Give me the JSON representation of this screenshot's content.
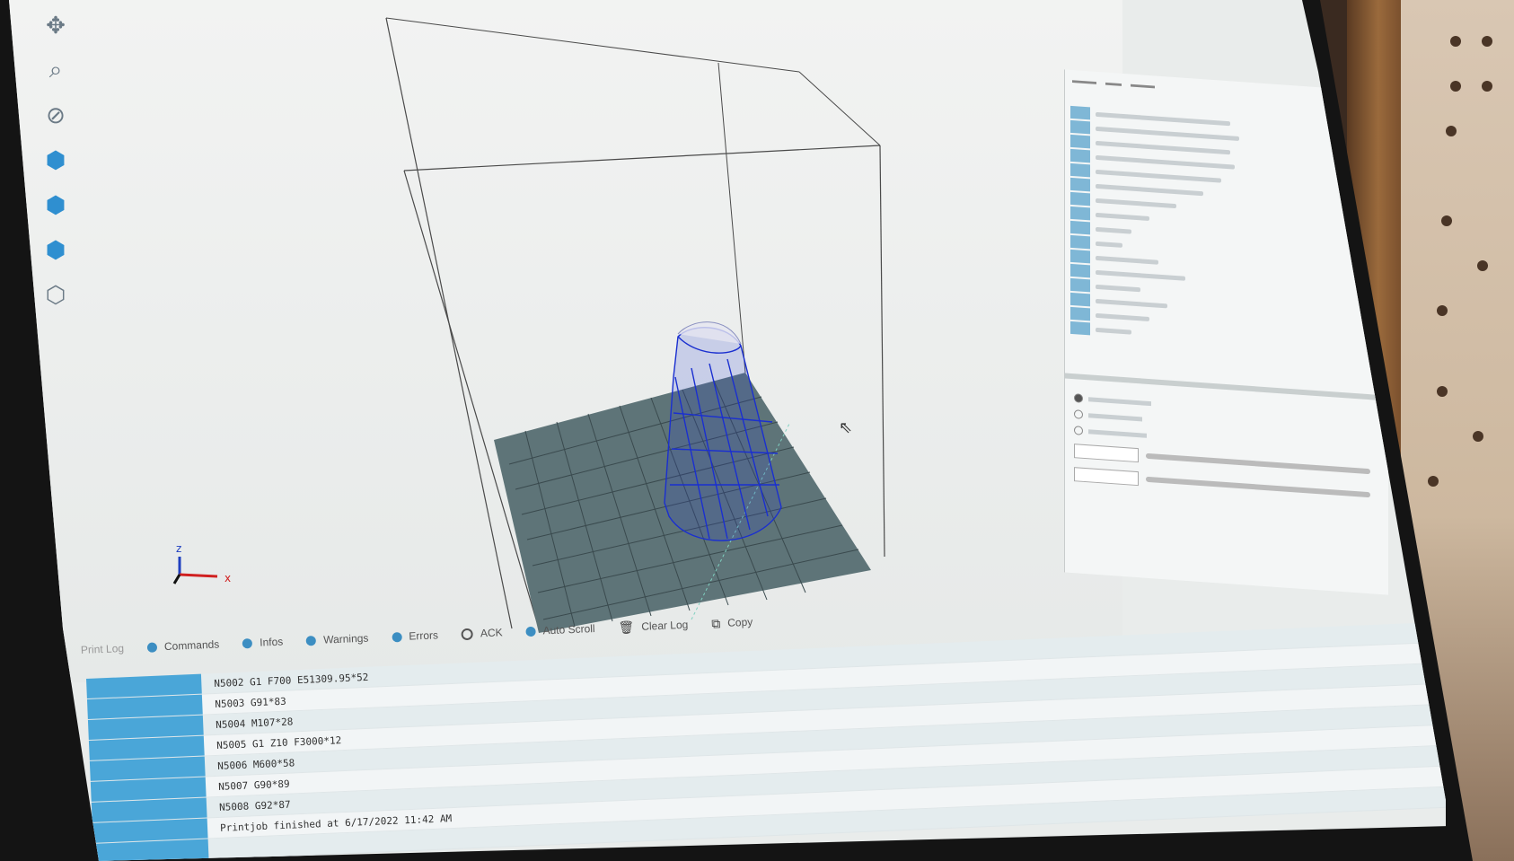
{
  "viewport": {
    "tools": [
      {
        "name": "move-icon",
        "glyph": "✥"
      },
      {
        "name": "zoom-icon",
        "glyph": "🔍"
      },
      {
        "name": "rotate-icon",
        "glyph": "⊘"
      },
      {
        "name": "cube-front-icon",
        "glyph": "⬢"
      },
      {
        "name": "cube-side-icon",
        "glyph": "⬢"
      },
      {
        "name": "cube-top-icon",
        "glyph": "⬢"
      },
      {
        "name": "cube-wire-icon",
        "glyph": "⬡"
      }
    ],
    "axis": {
      "x": "x",
      "z": "z"
    },
    "colors": {
      "model": "#1a2fd0",
      "bed": "#5e7478",
      "grid": "#3a4a4e"
    }
  },
  "log_toolbar": {
    "title": "Print Log",
    "options": [
      {
        "label": "Commands",
        "state": "on"
      },
      {
        "label": "Infos",
        "state": "on"
      },
      {
        "label": "Warnings",
        "state": "on"
      },
      {
        "label": "Errors",
        "state": "on"
      },
      {
        "label": "ACK",
        "state": "off"
      },
      {
        "label": "Auto Scroll",
        "state": "on"
      }
    ],
    "clear_log": "Clear Log",
    "copy": "Copy"
  },
  "log": [
    {
      "time": "",
      "msg": "N5002 G1 F700 E51309.95*52"
    },
    {
      "time": "",
      "msg": "N5003 G91*83"
    },
    {
      "time": "",
      "msg": "N5004 M107*28"
    },
    {
      "time": "",
      "msg": "N5005 G1 Z10 F3000*12"
    },
    {
      "time": "",
      "msg": "N5006 M600*58"
    },
    {
      "time": "",
      "msg": "N5007 G90*89"
    },
    {
      "time": "",
      "msg": "N5008 G92*87"
    },
    {
      "time": "",
      "msg": "Printjob finished at 6/17/2022 11:42 AM"
    },
    {
      "time": "",
      "msg": ""
    }
  ]
}
